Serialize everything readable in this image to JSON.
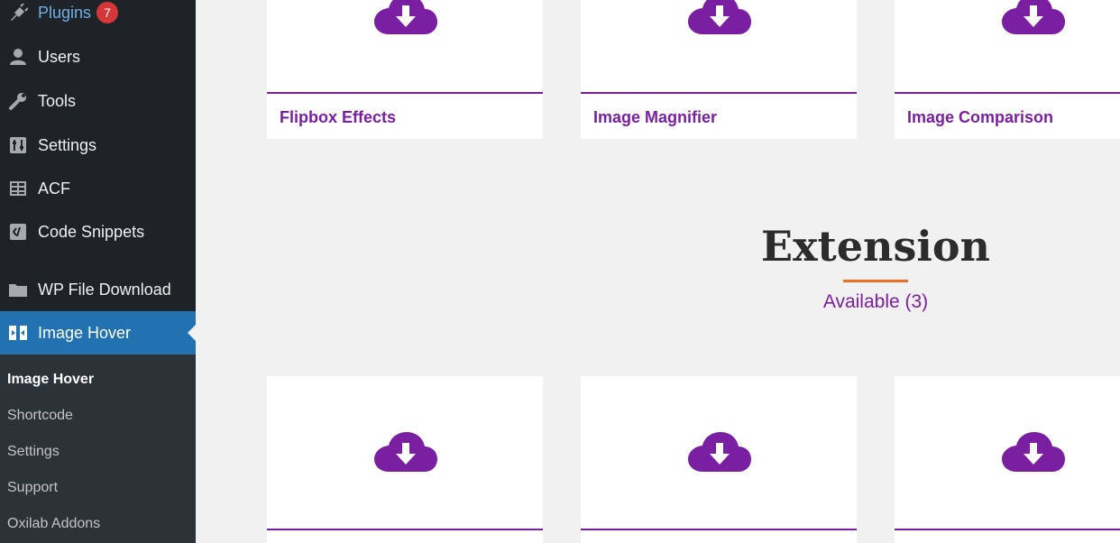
{
  "sidebar": {
    "items": [
      {
        "label": "Plugins",
        "icon": "plugin-icon",
        "badge": "7"
      },
      {
        "label": "Users",
        "icon": "users-icon"
      },
      {
        "label": "Tools",
        "icon": "tools-icon"
      },
      {
        "label": "Settings",
        "icon": "settings-icon"
      },
      {
        "label": "ACF",
        "icon": "acf-icon"
      },
      {
        "label": "Code Snippets",
        "icon": "code-snippets-icon"
      },
      {
        "label": "WP File Download",
        "icon": "folder-icon"
      },
      {
        "label": "Image Hover",
        "icon": "image-hover-icon",
        "active": true
      }
    ],
    "submenu": [
      "Image Hover",
      "Shortcode",
      "Settings",
      "Support",
      "Oxilab Addons"
    ]
  },
  "cards_top": [
    {
      "title": "Flipbox Effects"
    },
    {
      "title": "Image Magnifier"
    },
    {
      "title": "Image Comparison"
    }
  ],
  "extension": {
    "heading": "Extension",
    "subheading": "Available (3)"
  },
  "colors": {
    "accent": "#7a1fa2",
    "underline": "#f26d21",
    "sidebar_bg": "#1d2327",
    "active_bg": "#2271b1",
    "badge": "#d63638"
  }
}
